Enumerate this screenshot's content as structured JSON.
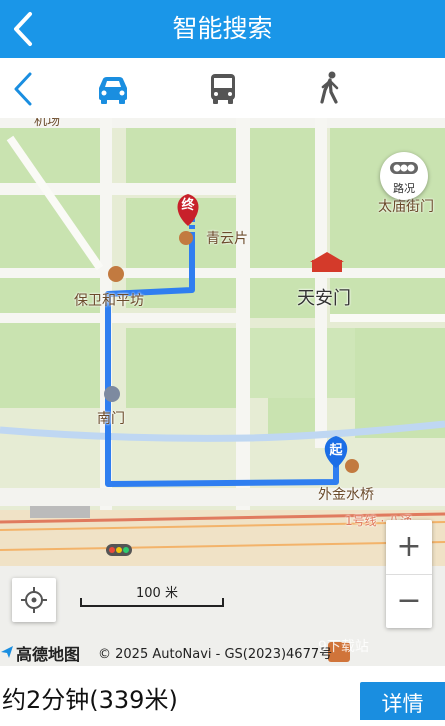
{
  "header": {
    "title": "智能搜索",
    "back_icon": "chevron-left-icon"
  },
  "modes": [
    {
      "name": "driving",
      "icon": "car-icon",
      "active": true
    },
    {
      "name": "bus",
      "icon": "bus-icon",
      "active": false
    },
    {
      "name": "walk",
      "icon": "walk-icon",
      "active": false
    }
  ],
  "map": {
    "labels": {
      "top_cut": "机场",
      "qingyunpian": "青云片",
      "baowei": "保卫和平坊",
      "tiananmen": "天安门",
      "nanmen": "南门",
      "waijinshuiqiao": "外金水桥",
      "taimiao": "太庙街门",
      "line1": "1号线 · 八通"
    },
    "end_marker": "终",
    "start_marker": "起",
    "traffic_button": "路况",
    "zoom_in": "+",
    "zoom_out": "−",
    "scale_label": "100 米",
    "logo": "高德地图",
    "copyright": "© 2025 AutoNavi - GS(2023)4677号",
    "watermark": "9下载站"
  },
  "footer": {
    "summary": "约2分钟(339米)",
    "detail_button": "详情"
  },
  "colors": {
    "accent": "#1a96e8",
    "route": "#2f7ef0",
    "end_marker": "#c8202a",
    "start_marker": "#1b6ee6"
  }
}
